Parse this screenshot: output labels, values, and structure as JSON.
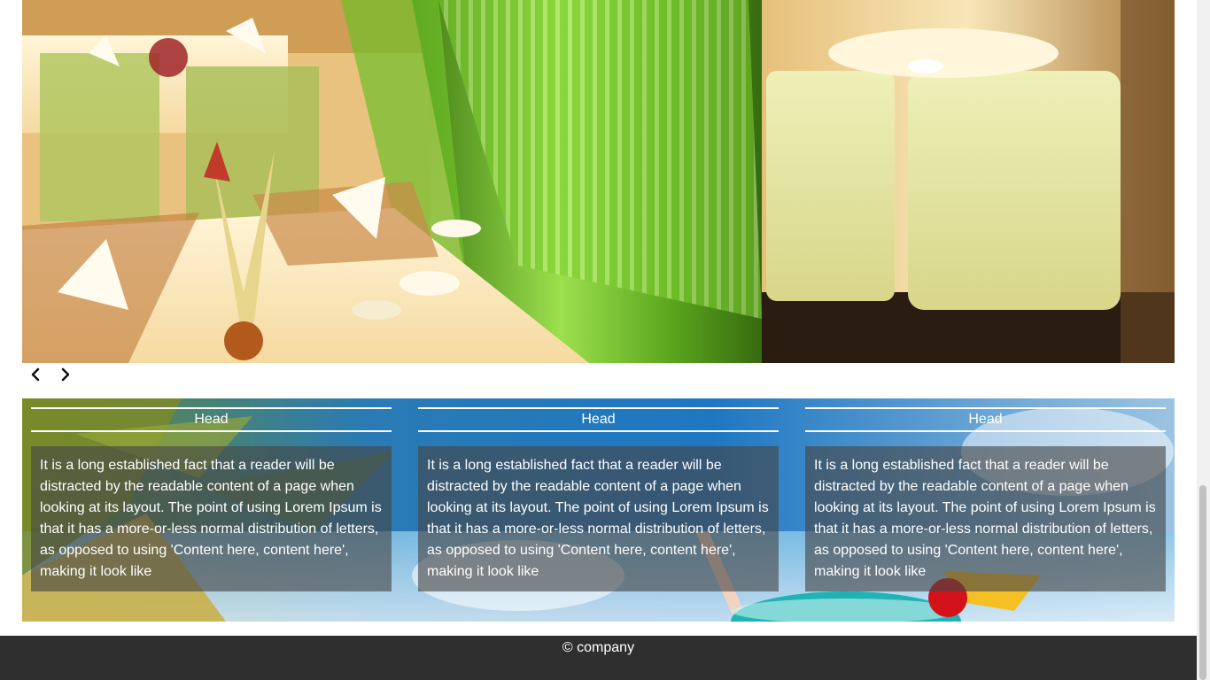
{
  "hero": {
    "image": "restaurant-interior"
  },
  "slider": {
    "prev_icon": "chevron-left-icon",
    "next_icon": "chevron-right-icon"
  },
  "features": [
    {
      "head": "Head",
      "text": "It is a long established fact that a reader will be distracted by the readable content of a page when looking at its layout. The point of using Lorem Ipsum is that it has a more-or-less normal distribution of letters, as opposed to using 'Content here, content here', making it look like"
    },
    {
      "head": "Head",
      "text": "It is a long established fact that a reader will be distracted by the readable content of a page when looking at its layout. The point of using Lorem Ipsum is that it has a more-or-less normal distribution of letters, as opposed to using 'Content here, content here', making it look like"
    },
    {
      "head": "Head",
      "text": "It is a long established fact that a reader will be distracted by the readable content of a page when looking at its layout. The point of using Lorem Ipsum is that it has a more-or-less normal distribution of letters, as opposed to using 'Content here, content here', making it look like"
    }
  ],
  "footer": {
    "text": "© company"
  },
  "colors": {
    "footer_bg": "#2f2f2f",
    "accent_green": "#6fbf2a",
    "panel_overlay": "rgba(70,70,70,0.62)"
  }
}
